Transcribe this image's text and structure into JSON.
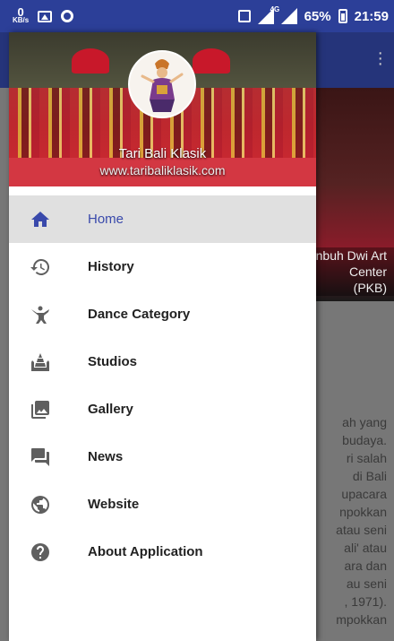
{
  "status_bar": {
    "net_speed_value": "0",
    "net_speed_unit": "KB/s",
    "network_type": "4G",
    "battery": "65%",
    "time": "21:59"
  },
  "background_app": {
    "caption": "nbuh Dwi Art Center (PKB)",
    "text_lines": [
      "ah yang",
      "budaya.",
      "ri salah",
      "di Bali",
      "upacara",
      "npokkan",
      "atau seni",
      "ali' atau",
      "ara dan",
      "au seni",
      ", 1971).",
      "mpokkan"
    ]
  },
  "drawer": {
    "header": {
      "title": "Tari Bali Klasik",
      "url": "www.taribaliklasik.com"
    },
    "items": [
      {
        "label": "Home",
        "icon": "home-icon",
        "selected": true
      },
      {
        "label": "History",
        "icon": "history-icon",
        "selected": false
      },
      {
        "label": "Dance Category",
        "icon": "dance-icon",
        "selected": false
      },
      {
        "label": "Studios",
        "icon": "temple-icon",
        "selected": false
      },
      {
        "label": "Gallery",
        "icon": "gallery-icon",
        "selected": false
      },
      {
        "label": "News",
        "icon": "news-icon",
        "selected": false
      },
      {
        "label": "Website",
        "icon": "globe-icon",
        "selected": false
      },
      {
        "label": "About Application",
        "icon": "help-icon",
        "selected": false
      }
    ]
  },
  "colors": {
    "primary": "#2c3f98",
    "accent": "#3949ab",
    "icon": "#5f5f5f"
  }
}
